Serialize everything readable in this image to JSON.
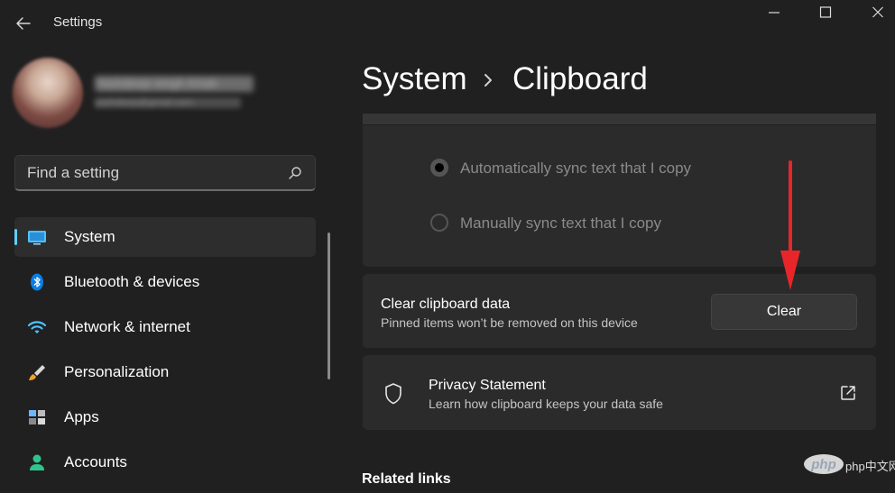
{
  "window": {
    "title": "Settings"
  },
  "profile": {
    "name": "Yashdeep singh Khati",
    "email": "yashdeep@gmail.com"
  },
  "search": {
    "placeholder": "Find a setting"
  },
  "sidebar": {
    "items": [
      {
        "label": "System",
        "icon": "monitor-icon",
        "active": true
      },
      {
        "label": "Bluetooth & devices",
        "icon": "bluetooth-icon"
      },
      {
        "label": "Network & internet",
        "icon": "wifi-icon"
      },
      {
        "label": "Personalization",
        "icon": "paintbrush-icon"
      },
      {
        "label": "Apps",
        "icon": "apps-icon"
      },
      {
        "label": "Accounts",
        "icon": "person-icon"
      }
    ]
  },
  "breadcrumb": {
    "parent": "System",
    "current": "Clipboard"
  },
  "sync": {
    "options": [
      {
        "label": "Automatically sync text that I copy",
        "selected": true
      },
      {
        "label": "Manually sync text that I copy",
        "selected": false
      }
    ]
  },
  "clear_card": {
    "title": "Clear clipboard data",
    "subtitle": "Pinned items won’t be removed on this device",
    "button": "Clear"
  },
  "privacy_card": {
    "title": "Privacy Statement",
    "subtitle": "Learn how clipboard keeps your data safe",
    "icon": "shield-icon",
    "link_icon": "external-link-icon"
  },
  "related_links": {
    "heading": "Related links"
  },
  "watermark": {
    "text": "php中文网"
  },
  "colors": {
    "accent": "#60cdff",
    "background": "#202020",
    "card": "#2b2b2b",
    "annotation_arrow": "#e8262a"
  }
}
